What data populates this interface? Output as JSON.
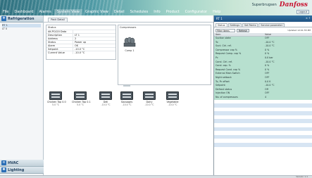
{
  "menu": [
    "File",
    "Dashboard",
    "Alarms",
    "System View",
    "Graphic View",
    "Detail",
    "Schedules",
    "Info",
    "Product",
    "Configurator",
    "Help"
  ],
  "menu_active": "System View",
  "brand": {
    "store": "Superbrugsen",
    "logo": "Danfoss",
    "logout": "Logout"
  },
  "sidebar": {
    "header": "Refrigeration",
    "tree": [
      "RT 1",
      "LT 0"
    ],
    "hvac": "HVAC",
    "lighting": "Lighting"
  },
  "main": {
    "tab": "Pack Detail",
    "status": {
      "title": "Status",
      "rows": [
        {
          "k": "AK-PC420 Data",
          "v": ""
        },
        {
          "k": "Description",
          "v": "LT 1"
        },
        {
          "k": "Address",
          "v": "2"
        },
        {
          "k": "Status",
          "v": "Power up"
        },
        {
          "k": "Alarm",
          "v": "OK"
        },
        {
          "k": "Setpoint",
          "v": "-10.0 °C"
        },
        {
          "k": "Current Value",
          "v": "-10.0 °C"
        }
      ]
    },
    "compressors": {
      "title": "Compressors",
      "label": "Comp 1"
    },
    "cases": [
      {
        "name": "Chicken Top 0.0",
        "temp": "5.0 °C"
      },
      {
        "name": "Chicken Top 0.1",
        "temp": "5.0 °C"
      },
      {
        "name": "Deli",
        "temp": "-10.0 °C"
      },
      {
        "name": "Sausages",
        "temp": "-10.0 °C"
      },
      {
        "name": "Dairy",
        "temp": "-10.0 °C"
      },
      {
        "name": "Vegetable",
        "temp": "-10.0 °C"
      }
    ]
  },
  "right": {
    "title": "RT 1",
    "controls": "✕ ↑",
    "tabs": [
      "Status",
      "Settings",
      "Set Points",
      "Service parameter"
    ],
    "filter": {
      "select": "Filter items",
      "button": "Refresh",
      "updated": "Updated 12:01:55 PM"
    },
    "columns": [
      "Item",
      "Value"
    ],
    "rows": [
      {
        "name": "Suction state",
        "value": "OFF"
      },
      {
        "name": "To",
        "value": "-10.0 °C"
      },
      {
        "name": "Suct. Ctrl. ref.",
        "value": "-10.0 °C"
      },
      {
        "name": "Compressor cap %",
        "value": "0 %"
      },
      {
        "name": "Request Comp. cap %",
        "value": "0 %"
      },
      {
        "name": "Pc",
        "value": "0.0 bar"
      },
      {
        "name": "Cond. Ctrl. ref.",
        "value": "-10.0 °C"
      },
      {
        "name": "Cond. cap. %",
        "value": "0 %"
      },
      {
        "name": "Request Cond. cap %",
        "value": "0 %"
      },
      {
        "name": "External Main Switch",
        "value": "OFF"
      },
      {
        "name": "Night setback",
        "value": "OFF"
      },
      {
        "name": "To, Pc offset",
        "value": "0.0 K"
      },
      {
        "name": "Setpoint",
        "value": "-10.0 °C"
      },
      {
        "name": "Defrost status",
        "value": "Off"
      },
      {
        "name": "Injection ON",
        "value": "OFF"
      },
      {
        "name": "No. of compressors",
        "value": "4"
      }
    ]
  },
  "footer": {
    "version": "Version 1.1"
  }
}
